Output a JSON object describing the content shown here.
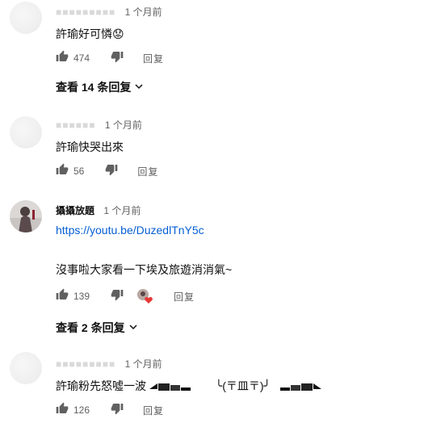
{
  "comments": [
    {
      "author": "",
      "time": "1 个月前",
      "text": "許瑜好可憐😟",
      "likes": "474",
      "reply_label": "回复",
      "view_replies": "查看 14 条回复"
    },
    {
      "author": "",
      "time": "1 个月前",
      "text": "許瑜快哭出來",
      "likes": "56",
      "reply_label": "回复"
    },
    {
      "author": "攝攝放題",
      "time": "1 个月前",
      "link": "https://youtu.be/DuzedlTnY5c",
      "text": "沒事啦大家看一下埃及旅遊消消氣~",
      "likes": "139",
      "reply_label": "回复",
      "view_replies": "查看 2 条回复"
    },
    {
      "author": "",
      "time": "1 个月前",
      "text": "許瑜粉先怒噓一波",
      "emoticon": "╰(〒皿〒)╯",
      "likes": "126",
      "reply_label": "回复"
    }
  ],
  "colors": {
    "link": "#065fd4",
    "heart": "#e53935",
    "meta": "#606060"
  }
}
